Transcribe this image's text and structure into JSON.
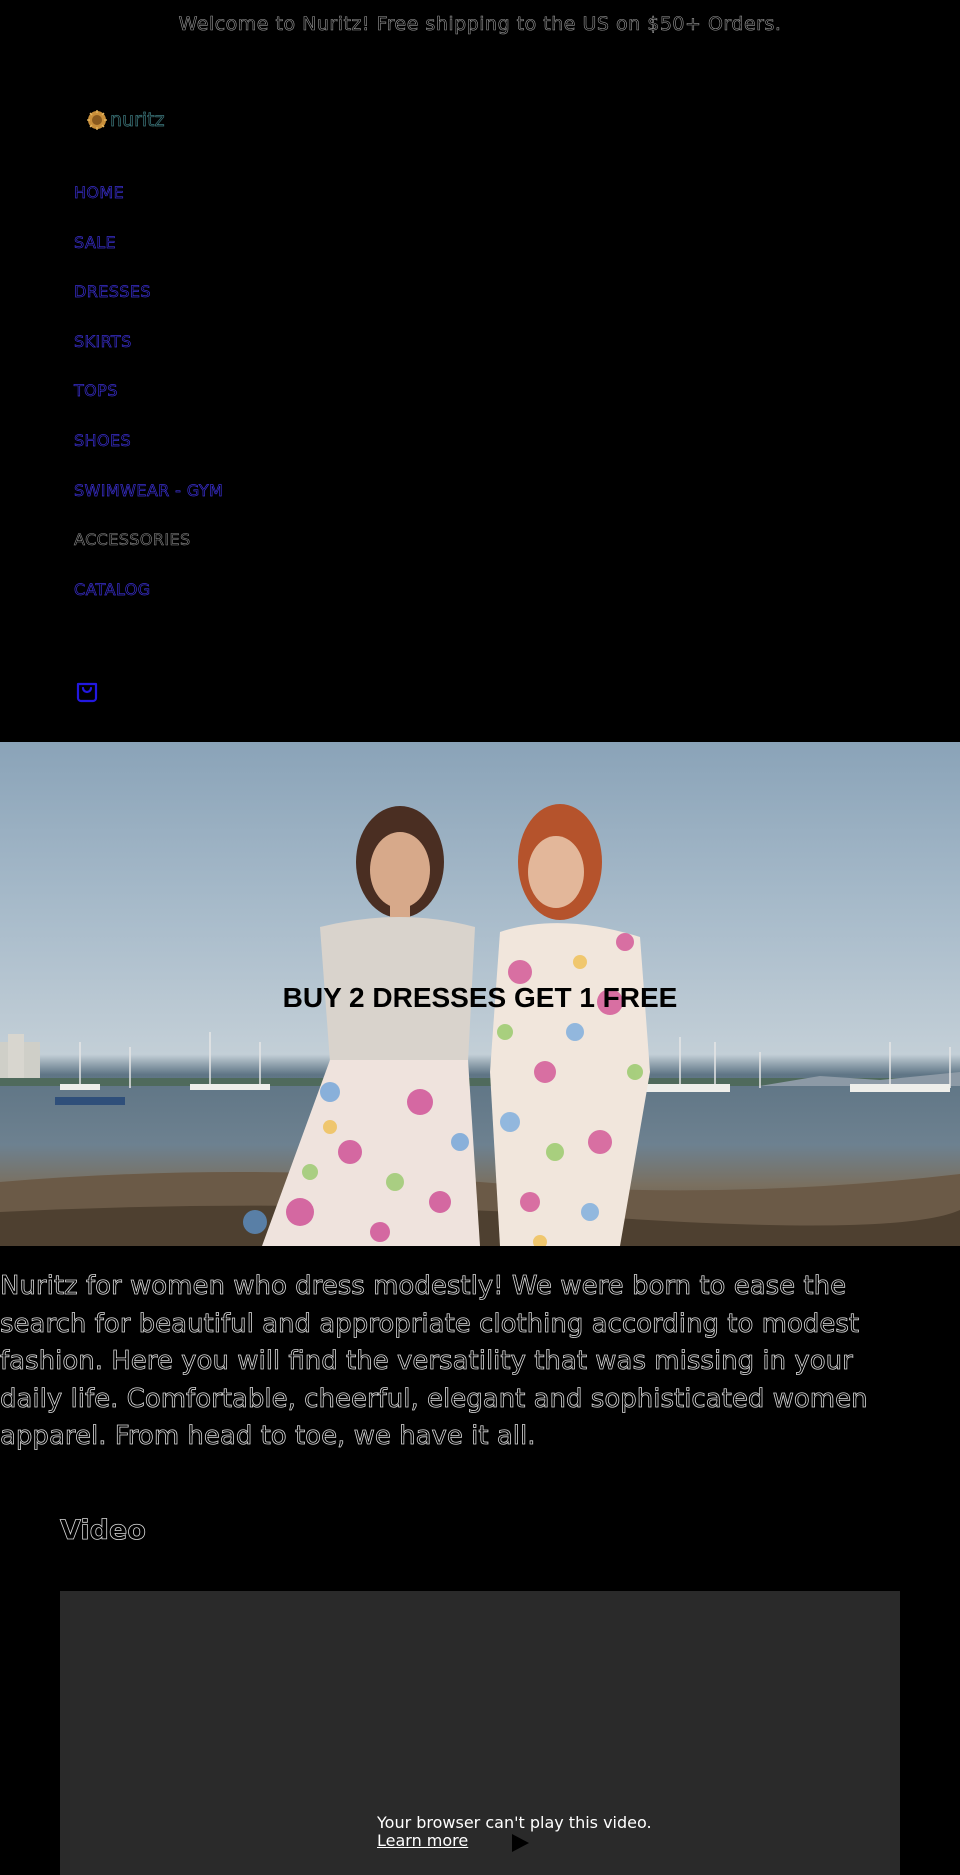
{
  "announcement": {
    "text": "Welcome to Nuritz! Free shipping to the US on $50+ Orders."
  },
  "logo": {
    "text": "nuritz",
    "icon": "sunflower-logo-icon"
  },
  "nav": {
    "items": [
      {
        "label": "HOME"
      },
      {
        "label": "SALE"
      },
      {
        "label": "DRESSES"
      },
      {
        "label": "SKIRTS"
      },
      {
        "label": "TOPS"
      },
      {
        "label": "SHOES"
      },
      {
        "label": "SWIMWEAR - GYM"
      },
      {
        "label": "ACCESSORIES"
      },
      {
        "label": "CATALOG"
      }
    ]
  },
  "header": {
    "cart_icon": "bag-icon"
  },
  "hero": {
    "title": "BUY 2 DRESSES GET 1 FREE",
    "image_alt": "Two women in floral outfits standing at a beach harbor"
  },
  "about": {
    "text": "Nuritz for women who dress modestly! We were born to ease the search for beautiful and appropriate clothing according to modest fashion. Here you will find the versatility that was missing in your daily life. Comfortable, cheerful, elegant and sophisticated women apparel. From head to toe, we have it all."
  },
  "video": {
    "heading": "Video",
    "message": "Your browser can't play this video.",
    "link": "Learn more",
    "play_icon": "play-icon"
  },
  "colors": {
    "background": "#000000",
    "nav_link": "#3a2fd0",
    "video_bg": "#2a2a2a"
  }
}
